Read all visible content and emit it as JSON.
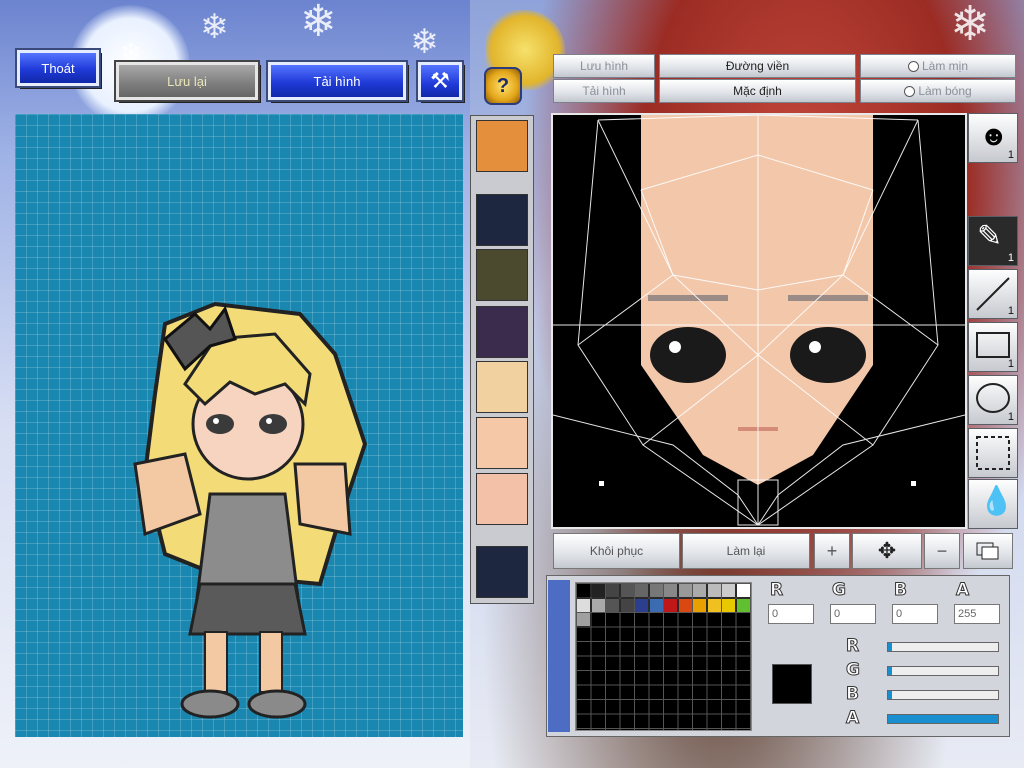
{
  "toolbar": {
    "exit_label": "Thoát",
    "save_label": "Lưu lại",
    "reload_label": "Tải hình",
    "hammer_icon": "hammer-icon",
    "help_icon": "help-icon"
  },
  "editor_top": {
    "save_image_label": "Lưu hình",
    "load_image_label": "Tải hình",
    "outline_label": "Đường viền",
    "default_label": "Mặc định",
    "smooth_label": "Làm mịn",
    "shine_label": "Làm bóng"
  },
  "thumbnails": [
    {
      "name": "head-thumb",
      "color": "#e48f3b"
    },
    {
      "name": "empty-slot",
      "color": "#1d2740"
    },
    {
      "name": "creature-thumb",
      "color": "#4b4a2f"
    },
    {
      "name": "dress-thumb",
      "color": "#3b2c4e"
    },
    {
      "name": "face-thumb",
      "color": "#f1d19f"
    },
    {
      "name": "skin-thumb",
      "color": "#f5c8a8"
    },
    {
      "name": "lips-thumb",
      "color": "#f2c1a7"
    },
    {
      "name": "empty-slot-2",
      "color": "#1d2740"
    }
  ],
  "right_tools": [
    {
      "name": "face-layer-tool",
      "count": "1"
    },
    {
      "name": "pen-tool",
      "count": "1"
    },
    {
      "name": "line-tool",
      "count": "1"
    },
    {
      "name": "rectangle-tool",
      "count": "1"
    },
    {
      "name": "ellipse-tool",
      "count": "1"
    },
    {
      "name": "select-tool",
      "count": ""
    },
    {
      "name": "eyedropper-tool",
      "count": ""
    }
  ],
  "bottom_controls": {
    "restore_label": "Khôi phục",
    "redo_label": "Làm lại"
  },
  "color": {
    "r_value": "0",
    "g_value": "0",
    "b_value": "0",
    "a_value": "255",
    "current": "#000000",
    "sliders": {
      "r": 0.0,
      "g": 0.0,
      "b": 0.0,
      "a": 1.0
    }
  },
  "palette": [
    "#000000",
    "#222222",
    "#444444",
    "#555555",
    "#666666",
    "#777777",
    "#888888",
    "#999999",
    "#aaaaaa",
    "#bbbbbb",
    "#cccccc",
    "#ffffff",
    "#dddddd",
    "#aaaaaa",
    "#555555",
    "#444444",
    "#2b3f8e",
    "#3b6bb0",
    "#c01818",
    "#d84810",
    "#e8a000",
    "#f0c020",
    "#e8c800",
    "#60c030",
    "#a0a0a0"
  ]
}
